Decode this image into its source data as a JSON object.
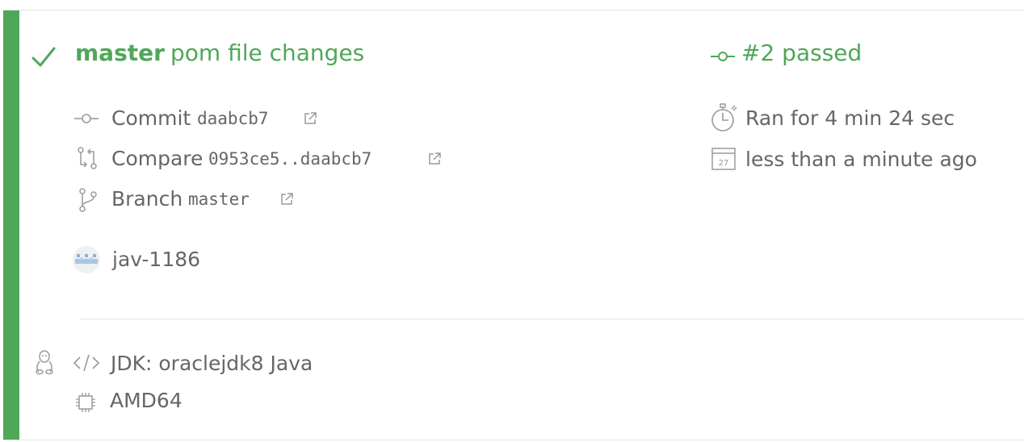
{
  "build": {
    "branch": "master",
    "message": "pom file changes",
    "number_status": "#2 passed",
    "commit_label": "Commit",
    "commit_sha": "daabcb7",
    "compare_label": "Compare",
    "compare_range": "0953ce5..daabcb7",
    "branch_label": "Branch",
    "branch_name": "master",
    "author": "jav-1186",
    "duration": "Ran for 4 min 24 sec",
    "finished": "less than a minute ago",
    "calendar_day": "27"
  },
  "environment": {
    "jdk": "JDK: oraclejdk8 Java",
    "arch": "AMD64"
  },
  "colors": {
    "passed": "#4fa758",
    "text": "#666666",
    "icon": "#9a9a9a"
  },
  "icons": [
    "check-icon",
    "commit-icon",
    "compare-icon",
    "branch-icon",
    "external-link-icon",
    "stopwatch-icon",
    "calendar-icon",
    "linux-icon",
    "code-icon",
    "cpu-icon"
  ]
}
